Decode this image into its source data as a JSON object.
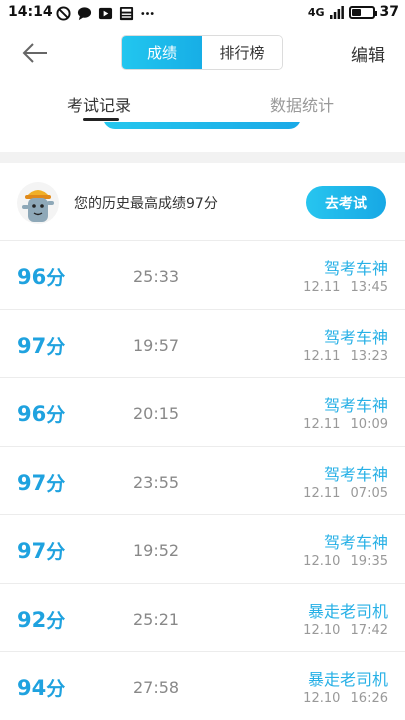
{
  "status_bar": {
    "time": "14:14",
    "network": "4G",
    "battery": "37",
    "icons": [
      "do-not-disturb-icon",
      "message-icon",
      "video-icon",
      "news-icon",
      "more-icon"
    ]
  },
  "nav": {
    "segments": [
      {
        "label": "成绩",
        "active": true
      },
      {
        "label": "排行榜",
        "active": false
      }
    ],
    "edit_label": "编辑"
  },
  "tabs": [
    {
      "label": "考试记录",
      "active": true
    },
    {
      "label": "数据统计",
      "active": false
    }
  ],
  "best": {
    "text": "您的历史最高成绩97分",
    "button_label": "去考试"
  },
  "records": [
    {
      "score": "96",
      "unit": "分",
      "duration": "25:33",
      "title": "驾考车神",
      "date": "12.11",
      "time": "13:45"
    },
    {
      "score": "97",
      "unit": "分",
      "duration": "19:57",
      "title": "驾考车神",
      "date": "12.11",
      "time": "13:23"
    },
    {
      "score": "96",
      "unit": "分",
      "duration": "20:15",
      "title": "驾考车神",
      "date": "12.11",
      "time": "10:09"
    },
    {
      "score": "97",
      "unit": "分",
      "duration": "23:55",
      "title": "驾考车神",
      "date": "12.11",
      "time": "07:05"
    },
    {
      "score": "97",
      "unit": "分",
      "duration": "19:52",
      "title": "驾考车神",
      "date": "12.10",
      "time": "19:35"
    },
    {
      "score": "92",
      "unit": "分",
      "duration": "25:21",
      "title": "暴走老司机",
      "date": "12.10",
      "time": "17:42"
    },
    {
      "score": "94",
      "unit": "分",
      "duration": "27:58",
      "title": "暴走老司机",
      "date": "12.10",
      "time": "16:26"
    }
  ],
  "colors": {
    "accent": "#1fa2df",
    "title_blue": "#27b0e6",
    "gradient_start": "#22c6ef",
    "gradient_end": "#17aee6"
  }
}
